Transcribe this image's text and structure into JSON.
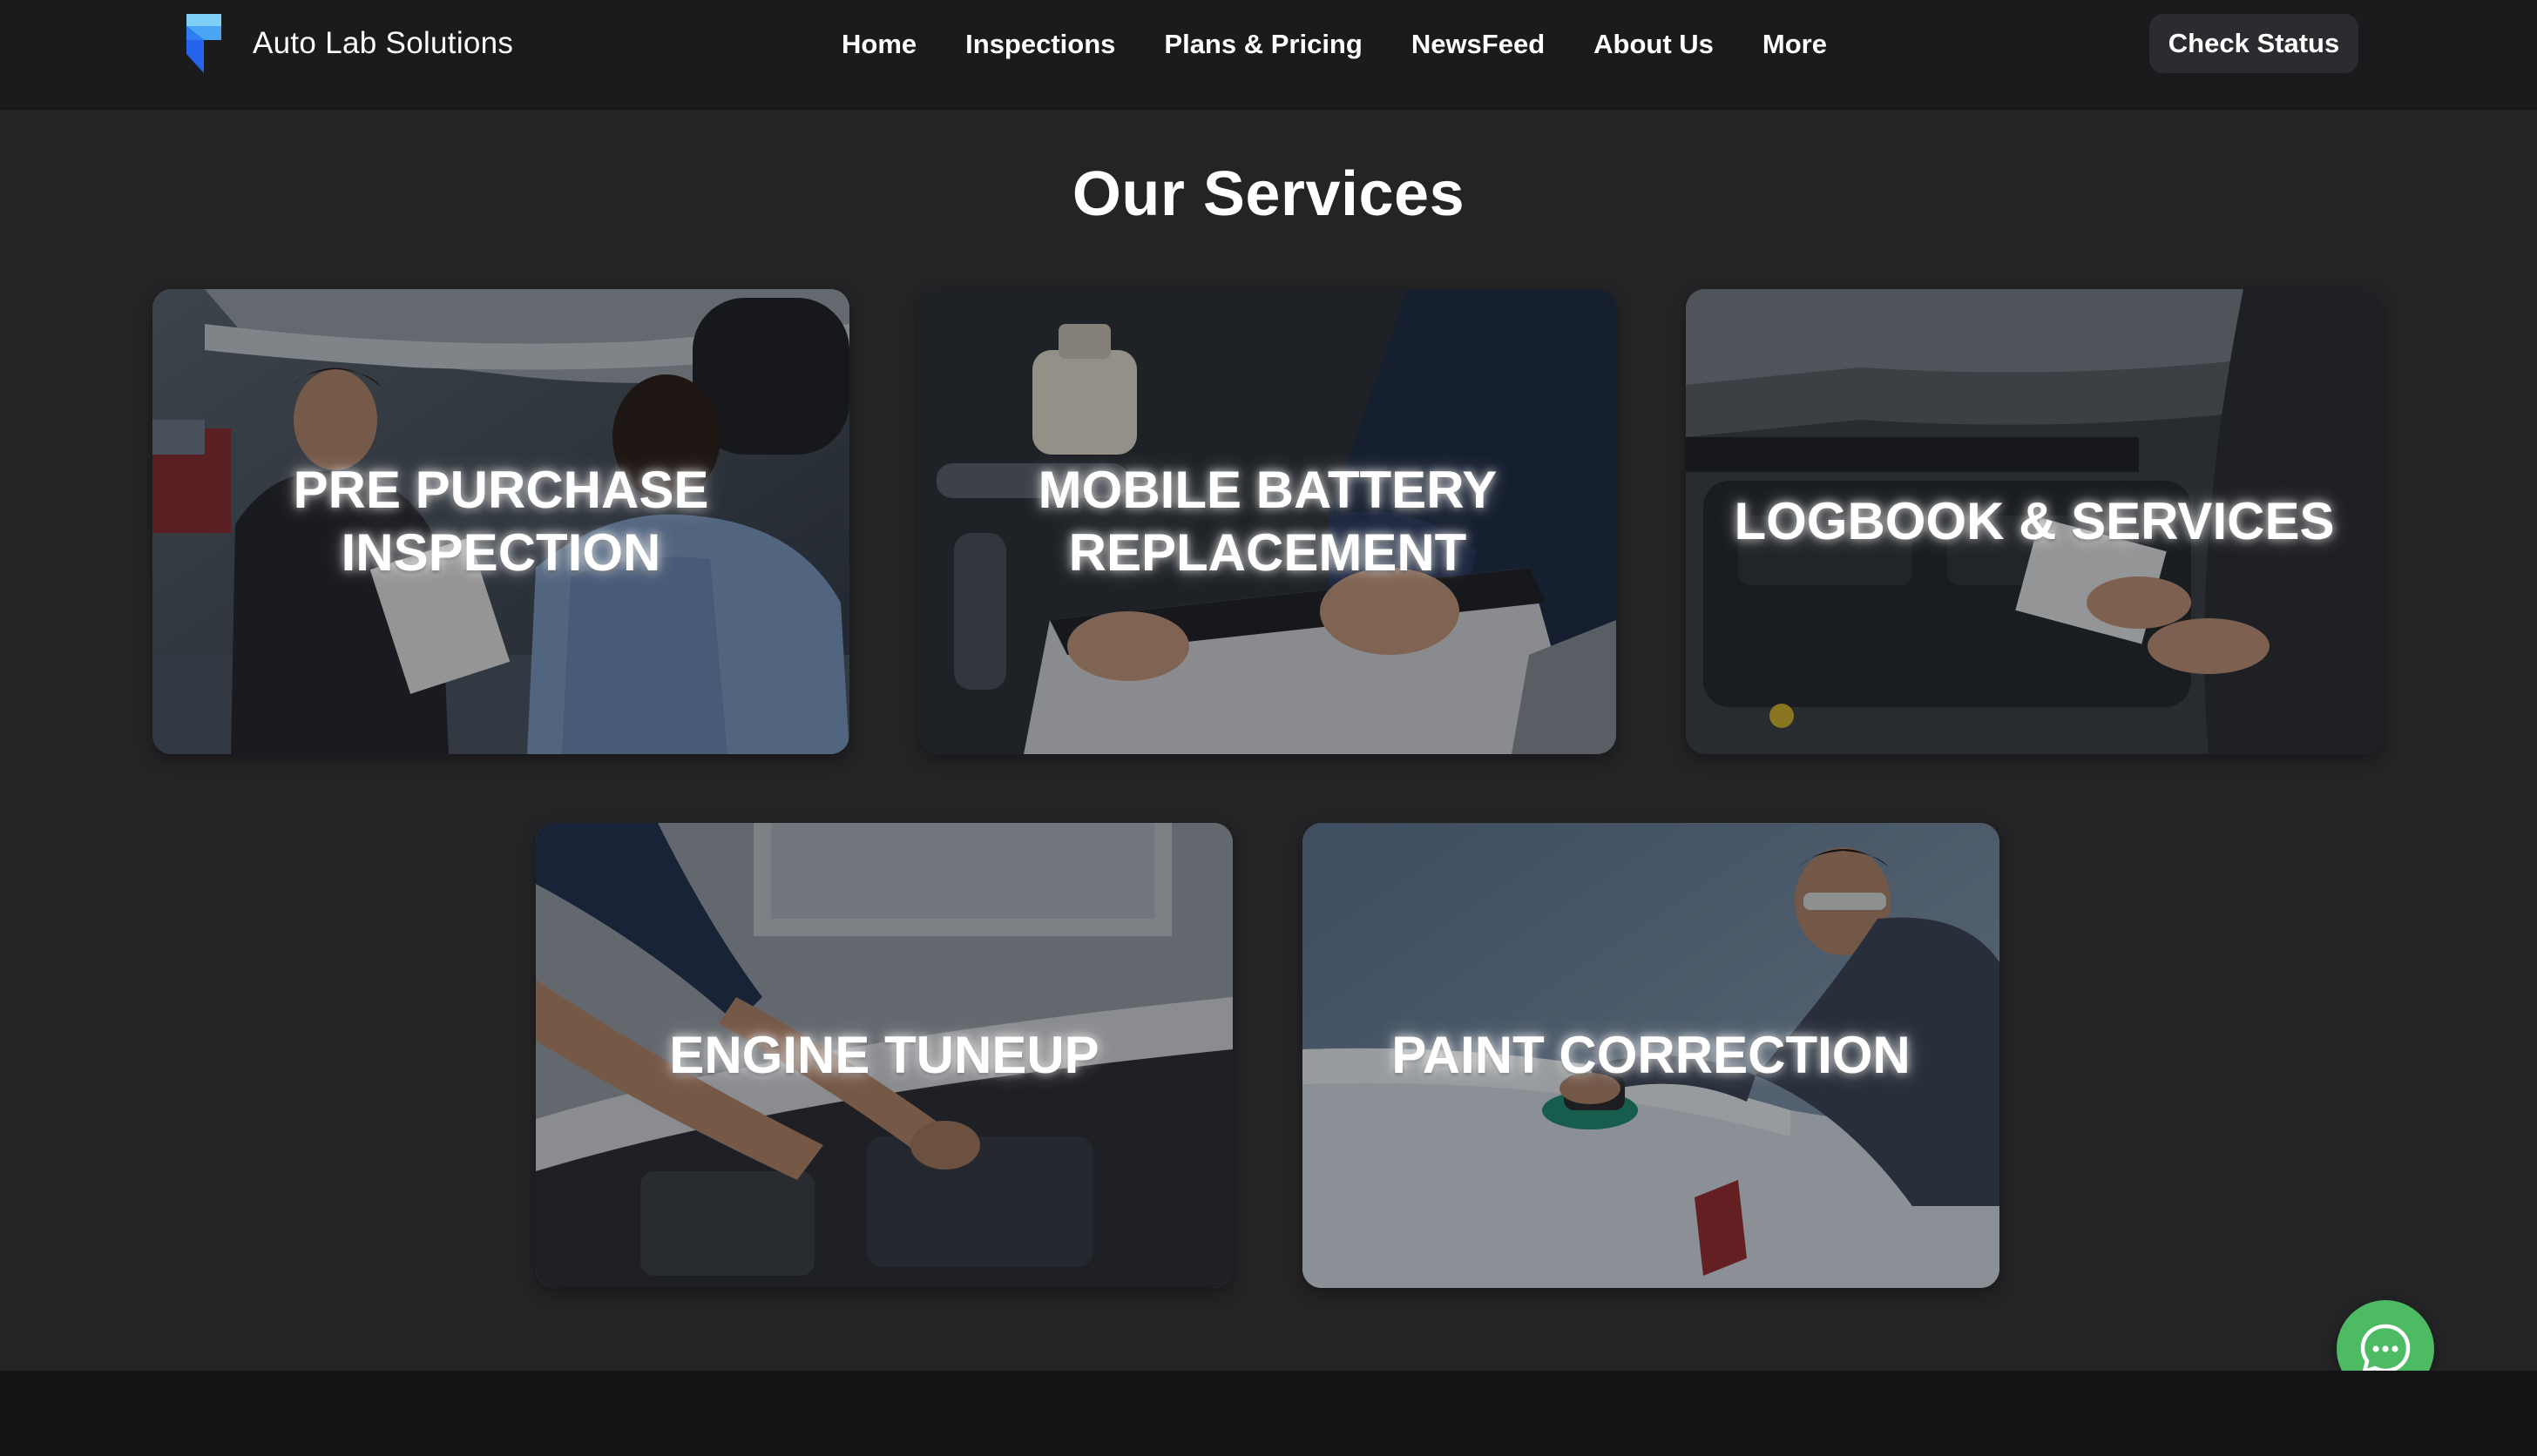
{
  "brand": {
    "name": "Auto Lab Solutions",
    "logo_icon": "framer-logo-icon"
  },
  "nav": {
    "items": [
      {
        "label": "Home"
      },
      {
        "label": "Inspections"
      },
      {
        "label": "Plans & Pricing"
      },
      {
        "label": "NewsFeed"
      },
      {
        "label": "About Us"
      },
      {
        "label": "More"
      }
    ],
    "cta_label": "Check Status"
  },
  "section": {
    "title": "Our Services"
  },
  "services": [
    {
      "label": "PRE PURCHASE INSPECTION",
      "image": "mechanics-under-car-photo"
    },
    {
      "label": "MOBILE BATTERY REPLACEMENT",
      "image": "battery-replacement-photo"
    },
    {
      "label": "LOGBOOK & SERVICES",
      "image": "engine-bay-clipboard-photo"
    },
    {
      "label": "ENGINE TUNEUP",
      "image": "engine-wrench-photo"
    },
    {
      "label": "PAINT CORRECTION",
      "image": "car-polishing-photo"
    }
  ],
  "chat": {
    "icon": "chat-bubble-icon"
  },
  "colors": {
    "background": "#242427",
    "navbar": "#1b1b1d",
    "footer": "#141416",
    "chat_button": "#4cbb63",
    "logo_blue": "#2f7cf6",
    "logo_light": "#67c6f5"
  }
}
